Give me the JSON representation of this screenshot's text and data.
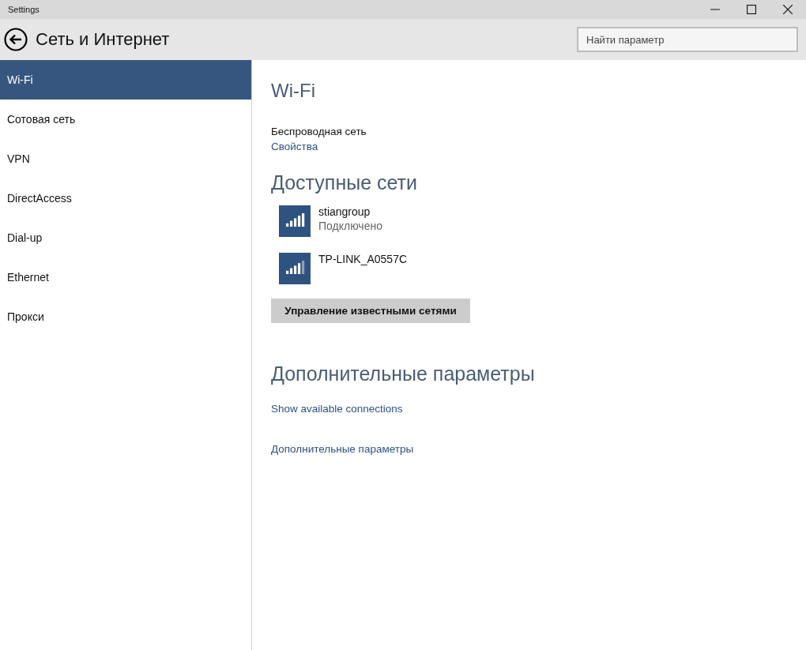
{
  "window": {
    "title": "Settings"
  },
  "header": {
    "title": "Сеть и Интернет",
    "search": {
      "placeholder": "Найти параметр"
    }
  },
  "sidebar": {
    "items": [
      {
        "label": "Wi-Fi",
        "selected": true
      },
      {
        "label": "Сотовая сеть",
        "selected": false
      },
      {
        "label": "VPN",
        "selected": false
      },
      {
        "label": "DirectAccess",
        "selected": false
      },
      {
        "label": "Dial-up",
        "selected": false
      },
      {
        "label": "Ethernet",
        "selected": false
      },
      {
        "label": "Прокси",
        "selected": false
      }
    ]
  },
  "content": {
    "title": "Wi-Fi",
    "wireless_label": "Беспроводная сеть",
    "properties_link": "Свойства",
    "networks_heading": "Доступные сети",
    "networks": [
      {
        "name": "stiangroup",
        "status": "Подключено",
        "full_signal": true
      },
      {
        "name": "TP-LINK_A0557C",
        "full_signal": false
      }
    ],
    "manage_button": "Управление известными сетями",
    "advanced_heading": "Дополнительные параметры",
    "links": [
      "Show available connections",
      "Дополнительные параметры"
    ]
  }
}
